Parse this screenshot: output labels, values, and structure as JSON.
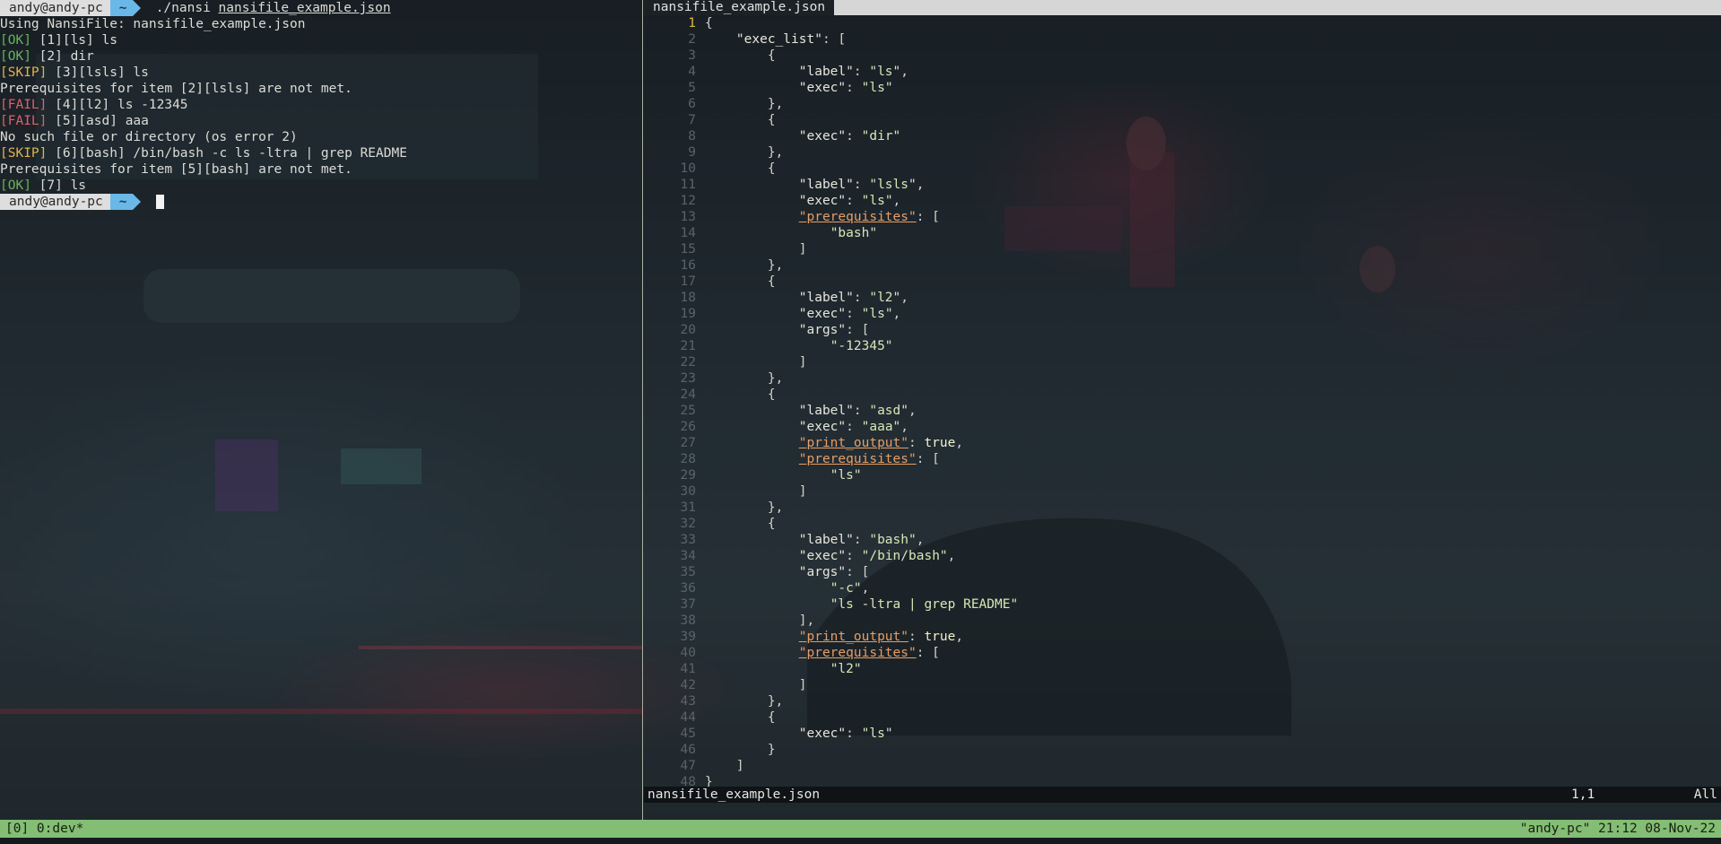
{
  "terminal": {
    "prompt_user": "andy@andy-pc",
    "prompt_dir": "~",
    "command": "./nansi",
    "command_arg": "nansifile_example.json",
    "output": [
      {
        "tag": "",
        "text": "Using NansiFile: nansifile_example.json"
      },
      {
        "tag": "[OK]",
        "status": "ok",
        "text": " [1][ls] ls"
      },
      {
        "tag": "[OK]",
        "status": "ok",
        "text": " [2] dir"
      },
      {
        "tag": "[SKIP]",
        "status": "skip",
        "text": " [3][lsls] ls"
      },
      {
        "tag": "",
        "text": "Prerequisites for item [2][lsls] are not met."
      },
      {
        "tag": "[FAIL]",
        "status": "fail",
        "text": " [4][l2] ls -12345"
      },
      {
        "tag": "[FAIL]",
        "status": "fail",
        "text": " [5][asd] aaa"
      },
      {
        "tag": "",
        "text": "No such file or directory (os error 2)"
      },
      {
        "tag": "[SKIP]",
        "status": "skip",
        "text": " [6][bash] /bin/bash -c ls -ltra | grep README"
      },
      {
        "tag": "",
        "text": "Prerequisites for item [5][bash] are not met."
      },
      {
        "tag": "[OK]",
        "status": "ok",
        "text": " [7] ls"
      }
    ]
  },
  "editor": {
    "tab_label": "nansifile_example.json",
    "status_file": "nansifile_example.json",
    "status_pos": "1,1",
    "status_scroll": "All",
    "current_line": 1,
    "lines": [
      [
        [
          "p",
          "{"
        ]
      ],
      [
        [
          "p",
          "    "
        ],
        [
          "k",
          "\"exec_list\""
        ],
        [
          "p",
          ": ["
        ]
      ],
      [
        [
          "p",
          "        {"
        ]
      ],
      [
        [
          "p",
          "            "
        ],
        [
          "k",
          "\"label\""
        ],
        [
          "p",
          ": "
        ],
        [
          "s",
          "\"ls\""
        ],
        [
          "p",
          ","
        ]
      ],
      [
        [
          "p",
          "            "
        ],
        [
          "k",
          "\"exec\""
        ],
        [
          "p",
          ": "
        ],
        [
          "s",
          "\"ls\""
        ]
      ],
      [
        [
          "p",
          "        },"
        ]
      ],
      [
        [
          "p",
          "        {"
        ]
      ],
      [
        [
          "p",
          "            "
        ],
        [
          "k",
          "\"exec\""
        ],
        [
          "p",
          ": "
        ],
        [
          "s",
          "\"dir\""
        ]
      ],
      [
        [
          "p",
          "        },"
        ]
      ],
      [
        [
          "p",
          "        {"
        ]
      ],
      [
        [
          "p",
          "            "
        ],
        [
          "k",
          "\"label\""
        ],
        [
          "p",
          ": "
        ],
        [
          "s",
          "\"lsls\""
        ],
        [
          "p",
          ","
        ]
      ],
      [
        [
          "p",
          "            "
        ],
        [
          "k",
          "\"exec\""
        ],
        [
          "p",
          ": "
        ],
        [
          "s",
          "\"ls\""
        ],
        [
          "p",
          ","
        ]
      ],
      [
        [
          "p",
          "            "
        ],
        [
          "pr",
          "\"prerequisites\""
        ],
        [
          "p",
          ": ["
        ]
      ],
      [
        [
          "p",
          "                "
        ],
        [
          "s",
          "\"bash\""
        ]
      ],
      [
        [
          "p",
          "            ]"
        ]
      ],
      [
        [
          "p",
          "        },"
        ]
      ],
      [
        [
          "p",
          "        {"
        ]
      ],
      [
        [
          "p",
          "            "
        ],
        [
          "k",
          "\"label\""
        ],
        [
          "p",
          ": "
        ],
        [
          "s",
          "\"l2\""
        ],
        [
          "p",
          ","
        ]
      ],
      [
        [
          "p",
          "            "
        ],
        [
          "k",
          "\"exec\""
        ],
        [
          "p",
          ": "
        ],
        [
          "s",
          "\"ls\""
        ],
        [
          "p",
          ","
        ]
      ],
      [
        [
          "p",
          "            "
        ],
        [
          "k",
          "\"args\""
        ],
        [
          "p",
          ": ["
        ]
      ],
      [
        [
          "p",
          "                "
        ],
        [
          "s",
          "\"-12345\""
        ]
      ],
      [
        [
          "p",
          "            ]"
        ]
      ],
      [
        [
          "p",
          "        },"
        ]
      ],
      [
        [
          "p",
          "        {"
        ]
      ],
      [
        [
          "p",
          "            "
        ],
        [
          "k",
          "\"label\""
        ],
        [
          "p",
          ": "
        ],
        [
          "s",
          "\"asd\""
        ],
        [
          "p",
          ","
        ]
      ],
      [
        [
          "p",
          "            "
        ],
        [
          "k",
          "\"exec\""
        ],
        [
          "p",
          ": "
        ],
        [
          "s",
          "\"aaa\""
        ],
        [
          "p",
          ","
        ]
      ],
      [
        [
          "p",
          "            "
        ],
        [
          "pr",
          "\"print_output\""
        ],
        [
          "p",
          ": "
        ],
        [
          "kw",
          "true"
        ],
        [
          "p",
          ","
        ]
      ],
      [
        [
          "p",
          "            "
        ],
        [
          "pr",
          "\"prerequisites\""
        ],
        [
          "p",
          ": ["
        ]
      ],
      [
        [
          "p",
          "                "
        ],
        [
          "s",
          "\"ls\""
        ]
      ],
      [
        [
          "p",
          "            ]"
        ]
      ],
      [
        [
          "p",
          "        },"
        ]
      ],
      [
        [
          "p",
          "        {"
        ]
      ],
      [
        [
          "p",
          "            "
        ],
        [
          "k",
          "\"label\""
        ],
        [
          "p",
          ": "
        ],
        [
          "s",
          "\"bash\""
        ],
        [
          "p",
          ","
        ]
      ],
      [
        [
          "p",
          "            "
        ],
        [
          "k",
          "\"exec\""
        ],
        [
          "p",
          ": "
        ],
        [
          "s",
          "\"/bin/bash\""
        ],
        [
          "p",
          ","
        ]
      ],
      [
        [
          "p",
          "            "
        ],
        [
          "k",
          "\"args\""
        ],
        [
          "p",
          ": ["
        ]
      ],
      [
        [
          "p",
          "                "
        ],
        [
          "s",
          "\"-c\""
        ],
        [
          "p",
          ","
        ]
      ],
      [
        [
          "p",
          "                "
        ],
        [
          "s",
          "\"ls -ltra | grep README\""
        ]
      ],
      [
        [
          "p",
          "            ],"
        ]
      ],
      [
        [
          "p",
          "            "
        ],
        [
          "pr",
          "\"print_output\""
        ],
        [
          "p",
          ": "
        ],
        [
          "kw",
          "true"
        ],
        [
          "p",
          ","
        ]
      ],
      [
        [
          "p",
          "            "
        ],
        [
          "pr",
          "\"prerequisites\""
        ],
        [
          "p",
          ": ["
        ]
      ],
      [
        [
          "p",
          "                "
        ],
        [
          "s",
          "\"l2\""
        ]
      ],
      [
        [
          "p",
          "            ]"
        ]
      ],
      [
        [
          "p",
          "        },"
        ]
      ],
      [
        [
          "p",
          "        {"
        ]
      ],
      [
        [
          "p",
          "            "
        ],
        [
          "k",
          "\"exec\""
        ],
        [
          "p",
          ": "
        ],
        [
          "s",
          "\"ls\""
        ]
      ],
      [
        [
          "p",
          "        }"
        ]
      ],
      [
        [
          "p",
          "    ]"
        ]
      ],
      [
        [
          "p",
          "}"
        ]
      ]
    ]
  },
  "tmux": {
    "left": "[0] 0:dev*",
    "right": "\"andy-pc\" 21:12 08-Nov-22"
  },
  "colors": {
    "ok": "#6bb35a",
    "fail": "#e0606a",
    "skip": "#e0b44c",
    "status_bar": "#84bd74",
    "prompt_arrow": "#6ab8e8"
  }
}
